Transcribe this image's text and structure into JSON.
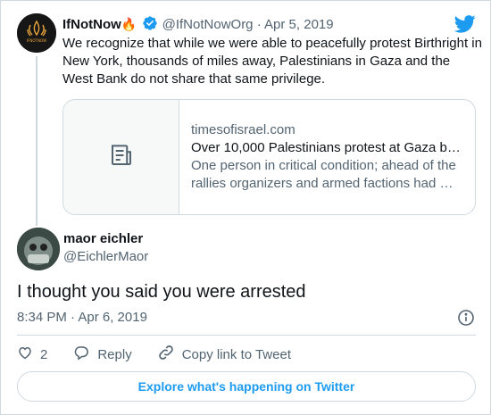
{
  "parent_tweet": {
    "author_name": "IfNotNow",
    "author_emoji": "🔥",
    "handle": "@IfNotNowOrg",
    "separator": "·",
    "date": "Apr 5, 2019",
    "avatar_text": "IFNOTNOW",
    "text": "We recognize that while we were able to peacefully protest Birthright in New York, thousands of miles away, Palestinians in Gaza and the West Bank do not share that same privilege.",
    "link_card": {
      "domain": "timesofisrael.com",
      "title": "Over 10,000 Palestinians protest at Gaza b…",
      "description": "One person in critical condition; ahead of the rallies organizers and armed factions had …",
      "thumb_icon": "document-icon"
    }
  },
  "reply": {
    "author_name": "maor eichler",
    "handle": "@EichlerMaor",
    "text": "I thought you said you were arrested",
    "timestamp": "8:34 PM · Apr 6, 2019"
  },
  "actions": {
    "like_count": "2",
    "reply_label": "Reply",
    "copy_label": "Copy link to Tweet"
  },
  "explore_label": "Explore what's happening on Twitter",
  "colors": {
    "accent": "#1d9bf0",
    "muted": "#536471",
    "border": "#cfd9de"
  }
}
